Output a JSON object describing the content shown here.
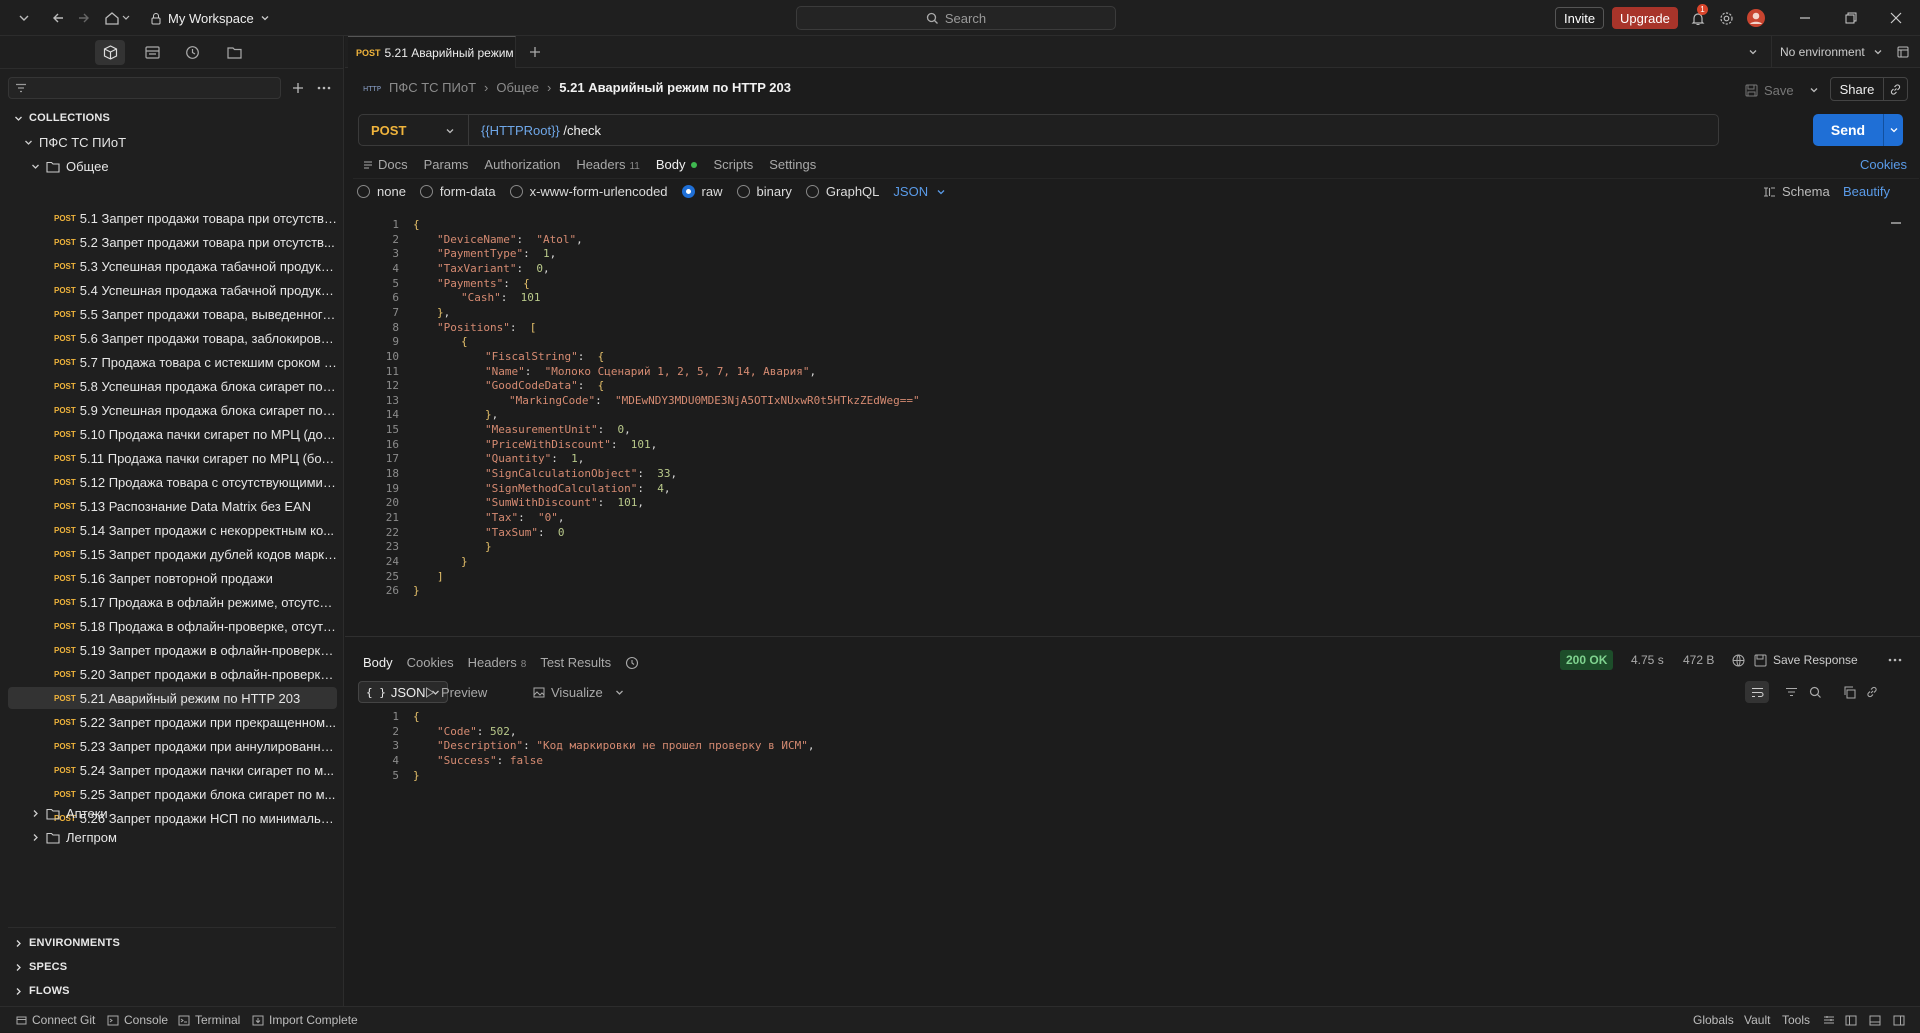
{
  "title_bar": {
    "workspace": "My Workspace",
    "search_placeholder": "Search",
    "invite": "Invite",
    "upgrade": "Upgrade",
    "notification_count": "1",
    "environment": "No environment"
  },
  "sidebar": {
    "filter_placeholder": "",
    "collections_label": "COLLECTIONS",
    "collection_name": "ПФС ТС ПИоТ",
    "folder_name": "Общее",
    "method": "POST",
    "requests": [
      "5.1 Запрет продажи товара при отсутстви...",
      "5.2 Запрет продажи товара при отсутств...",
      "5.3 Успешная продажа табачной продукц...",
      "5.4 Успешная продажа табачной продукц...",
      "5.5 Запрет продажи товара, выведенного...",
      "5.6 Запрет продажи товара, заблокирова...",
      "5.7 Продажа товара с истекшим сроком г...",
      "5.8 Успешная продажа блока сигарет по ...",
      "5.9 Успешная продажа блока сигарет по ...",
      "5.10 Продажа пачки сигарет по МРЦ (до 1...",
      "5.11 Продажа пачки сигарет по МРЦ (бол...",
      "5.12 Продажа товара с отсутствующими ...",
      "5.13 Распознание Data Matrix без EAN",
      "5.14 Запрет продажи с некорректным ко...",
      "5.15 Запрет продажи дублей кодов марки...",
      "5.16 Запрет повторной продажи",
      "5.17 Продажа в офлайн режиме, отсутств...",
      "5.18 Продажа в офлайн-проверке, отсутс...",
      "5.19 Запрет продажи в офлайн-проверке,...",
      "5.20 Запрет продажи в офлайн-проверке ...",
      "5.21 Аварийный режим по HTTP 203",
      "5.22 Запрет продажи при прекращенном...",
      "5.23 Запрет продажи при аннулированно...",
      "5.24 Запрет продажи пачки сигарет по м...",
      "5.25 Запрет продажи блока сигарет по м...",
      "5.26 Запрет продажи НСП по минимальн..."
    ],
    "other_folders": [
      "Аптеки",
      "Легпром"
    ],
    "sections": [
      "ENVIRONMENTS",
      "SPECS",
      "FLOWS"
    ]
  },
  "tab": {
    "method": "POST",
    "title": "5.21 Аварийный режим"
  },
  "request": {
    "breadcrumb": [
      "ПФС ТС ПИоТ",
      "Общее",
      "5.21 Аварийный режим по HTTP 203"
    ],
    "save": "Save",
    "share": "Share",
    "method": "POST",
    "url_var": "{{HTTPRoot}}",
    "url_path": " /check",
    "send": "Send",
    "tabs": [
      "Docs",
      "Params",
      "Authorization",
      "Headers",
      "Body",
      "Scripts",
      "Settings"
    ],
    "headers_count": "11",
    "cookies": "Cookies",
    "body_types": [
      "none",
      "form-data",
      "x-www-form-urlencoded",
      "raw",
      "binary",
      "GraphQL"
    ],
    "format": "JSON",
    "schema": "Schema",
    "beautify": "Beautify"
  },
  "response": {
    "tabs": [
      "Body",
      "Cookies",
      "Headers",
      "Test Results"
    ],
    "headers_count": "8",
    "status": "200 OK",
    "time": "4.75 s",
    "size": "472 B",
    "save_response": "Save Response",
    "view": "JSON",
    "preview": "Preview",
    "visualize": "Visualize"
  },
  "bottom_bar": {
    "connect_git": "Connect Git",
    "console": "Console",
    "terminal": "Terminal",
    "import": "Import Complete",
    "globals": "Globals",
    "vault": "Vault",
    "tools": "Tools"
  },
  "request_body_lines": [
    [
      [
        "p",
        "{"
      ]
    ],
    [
      [
        "k",
        "\"DeviceName\""
      ],
      [
        "d",
        ":  "
      ],
      [
        "s",
        "\"Atol\""
      ],
      [
        "d",
        ","
      ]
    ],
    [
      [
        "k",
        "\"PaymentType\""
      ],
      [
        "d",
        ":  "
      ],
      [
        "n",
        "1"
      ],
      [
        "d",
        ","
      ]
    ],
    [
      [
        "k",
        "\"TaxVariant\""
      ],
      [
        "d",
        ":  "
      ],
      [
        "n",
        "0"
      ],
      [
        "d",
        ","
      ]
    ],
    [
      [
        "k",
        "\"Payments\""
      ],
      [
        "d",
        ":  "
      ],
      [
        "p",
        "{"
      ]
    ],
    [
      [
        "k",
        "\"Cash\""
      ],
      [
        "d",
        ":  "
      ],
      [
        "n",
        "101"
      ]
    ],
    [
      [
        "p",
        "}"
      ],
      [
        "d",
        ","
      ]
    ],
    [
      [
        "k",
        "\"Positions\""
      ],
      [
        "d",
        ":  "
      ],
      [
        "p",
        "["
      ]
    ],
    [
      [
        "p",
        "{"
      ]
    ],
    [
      [
        "k",
        "\"FiscalString\""
      ],
      [
        "d",
        ":  "
      ],
      [
        "p",
        "{"
      ]
    ],
    [
      [
        "k",
        "\"Name\""
      ],
      [
        "d",
        ":  "
      ],
      [
        "s",
        "\"Молоко Сценарий 1, 2, 5, 7, 14, Авария\""
      ],
      [
        "d",
        ","
      ]
    ],
    [
      [
        "k",
        "\"GoodCodeData\""
      ],
      [
        "d",
        ":  "
      ],
      [
        "p",
        "{"
      ]
    ],
    [
      [
        "k",
        "\"MarkingCode\""
      ],
      [
        "d",
        ":  "
      ],
      [
        "s",
        "\"MDEwNDY3MDU0MDE3NjA5OTIxNUxwR0t5HTkzZEdWeg==\""
      ]
    ],
    [
      [
        "p",
        "}"
      ],
      [
        "d",
        ","
      ]
    ],
    [
      [
        "k",
        "\"MeasurementUnit\""
      ],
      [
        "d",
        ":  "
      ],
      [
        "n",
        "0"
      ],
      [
        "d",
        ","
      ]
    ],
    [
      [
        "k",
        "\"PriceWithDiscount\""
      ],
      [
        "d",
        ":  "
      ],
      [
        "n",
        "101"
      ],
      [
        "d",
        ","
      ]
    ],
    [
      [
        "k",
        "\"Quantity\""
      ],
      [
        "d",
        ":  "
      ],
      [
        "n",
        "1"
      ],
      [
        "d",
        ","
      ]
    ],
    [
      [
        "k",
        "\"SignCalculationObject\""
      ],
      [
        "d",
        ":  "
      ],
      [
        "n",
        "33"
      ],
      [
        "d",
        ","
      ]
    ],
    [
      [
        "k",
        "\"SignMethodCalculation\""
      ],
      [
        "d",
        ":  "
      ],
      [
        "n",
        "4"
      ],
      [
        "d",
        ","
      ]
    ],
    [
      [
        "k",
        "\"SumWithDiscount\""
      ],
      [
        "d",
        ":  "
      ],
      [
        "n",
        "101"
      ],
      [
        "d",
        ","
      ]
    ],
    [
      [
        "k",
        "\"Tax\""
      ],
      [
        "d",
        ":  "
      ],
      [
        "s",
        "\"0\""
      ],
      [
        "d",
        ","
      ]
    ],
    [
      [
        "k",
        "\"TaxSum\""
      ],
      [
        "d",
        ":  "
      ],
      [
        "n",
        "0"
      ]
    ],
    [
      [
        "p",
        "}"
      ]
    ],
    [
      [
        "p",
        "}"
      ]
    ],
    [
      [
        "p",
        "]"
      ]
    ],
    [
      [
        "p",
        "}"
      ]
    ]
  ],
  "request_body_indent": [
    0,
    1,
    1,
    1,
    1,
    2,
    1,
    1,
    2,
    3,
    3,
    3,
    4,
    3,
    3,
    3,
    3,
    3,
    3,
    3,
    3,
    3,
    3,
    2,
    1,
    0
  ],
  "response_body_lines": [
    [
      [
        "p",
        "{"
      ]
    ],
    [
      [
        "k",
        "\"Code\""
      ],
      [
        "d",
        ": "
      ],
      [
        "n",
        "502"
      ],
      [
        "d",
        ","
      ]
    ],
    [
      [
        "k",
        "\"Description\""
      ],
      [
        "d",
        ": "
      ],
      [
        "s",
        "\"Код маркировки не прошел проверку в ИСМ\""
      ],
      [
        "d",
        ","
      ]
    ],
    [
      [
        "k",
        "\"Success\""
      ],
      [
        "d",
        ": "
      ],
      [
        "s",
        "false"
      ]
    ],
    [
      [
        "p",
        "}"
      ]
    ]
  ],
  "response_body_indent": [
    0,
    1,
    1,
    1,
    0
  ],
  "colors": {
    "accent": "#1f6fd6",
    "method_post": "#f0b43c",
    "status_ok": "#7fd38f",
    "upgrade": "#a8342a"
  }
}
